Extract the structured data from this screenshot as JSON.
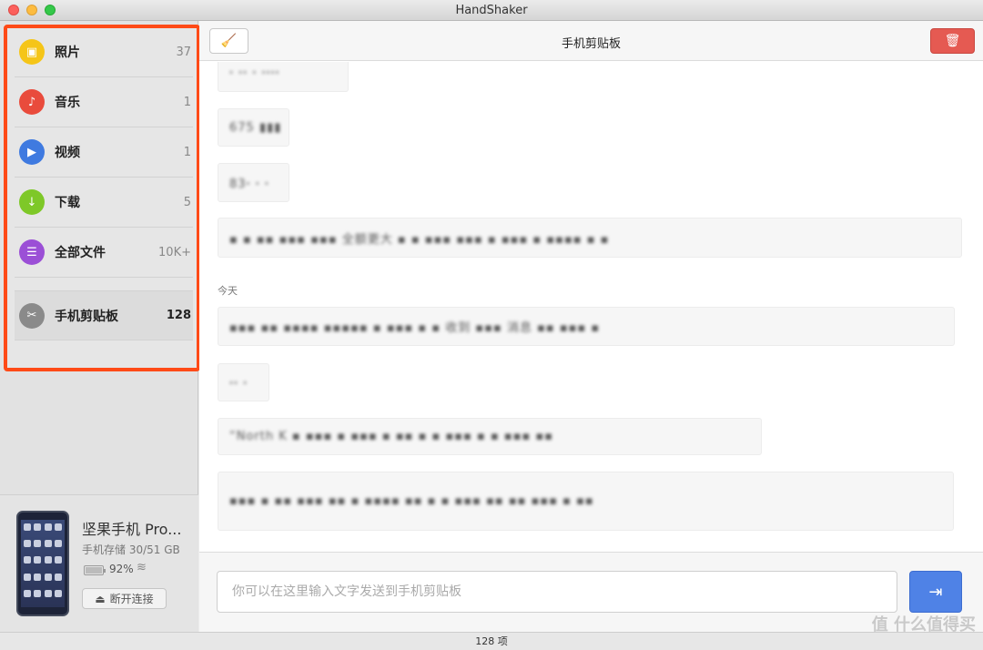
{
  "window": {
    "title": "HandShaker"
  },
  "sidebar": {
    "items": [
      {
        "label": "照片",
        "count": "37",
        "icon": "photo-icon",
        "color": "#f5c518"
      },
      {
        "label": "音乐",
        "count": "1",
        "icon": "music-icon",
        "color": "#e94b3c"
      },
      {
        "label": "视频",
        "count": "1",
        "icon": "video-play-icon",
        "color": "#3f7ae0"
      },
      {
        "label": "下载",
        "count": "5",
        "icon": "download-icon",
        "color": "#7ec828"
      },
      {
        "label": "全部文件",
        "count": "10K+",
        "icon": "file-icon",
        "color": "#9b4fd6"
      },
      {
        "label": "手机剪贴板",
        "count": "128",
        "icon": "scissors-icon",
        "color": "#8a8a8a"
      }
    ]
  },
  "device": {
    "name": "坚果手机 Pro...",
    "storage": "手机存储 30/51 GB",
    "battery": "92%",
    "battery_level": 0.92,
    "disconnect_label": "断开连接"
  },
  "toolbar": {
    "title": "手机剪贴板"
  },
  "feed": {
    "date_label": "今天",
    "messages": [
      {
        "text": "ꞏ ꞏꞏ ꞏ ꞏꞏꞏꞏ"
      },
      {
        "text": "675 ▮▮▮"
      },
      {
        "text": "83ꞏ ꞏ ꞏ"
      },
      {
        "text": "▪ ▪ ▪▪ ▪▪▪ ▪▪▪ 全额更大 ▪ ▪ ▪▪▪ ▪▪▪ ▪ ▪▪▪ ▪ ▪▪▪▪ ▪ ▪"
      },
      {
        "text": "▪▪▪ ▪▪ ▪▪▪▪ ▪▪▪▪▪ ▪ ▪▪▪ ▪ ▪ 收到 ▪▪▪ 消息 ▪▪ ▪▪▪ ▪"
      },
      {
        "text": "ꞏꞏ ꞏ"
      },
      {
        "text": "“North K ▪ ▪▪▪ ▪ ▪▪▪ ▪ ▪▪ ▪ ▪ ▪▪▪ ▪ ▪ ▪▪▪ ▪▪"
      },
      {
        "text": "▪▪▪ ▪ ▪▪ ▪▪▪ ▪▪ ▪ ▪▪▪▪ ▪▪ ▪ ▪ ▪▪▪ ▪▪ ▪▪ ▪▪▪ ▪ ▪▪"
      }
    ]
  },
  "composer": {
    "placeholder": "你可以在这里输入文字发送到手机剪贴板"
  },
  "status": {
    "text": "128 项"
  },
  "watermark": {
    "text": "值 什么值得买"
  }
}
